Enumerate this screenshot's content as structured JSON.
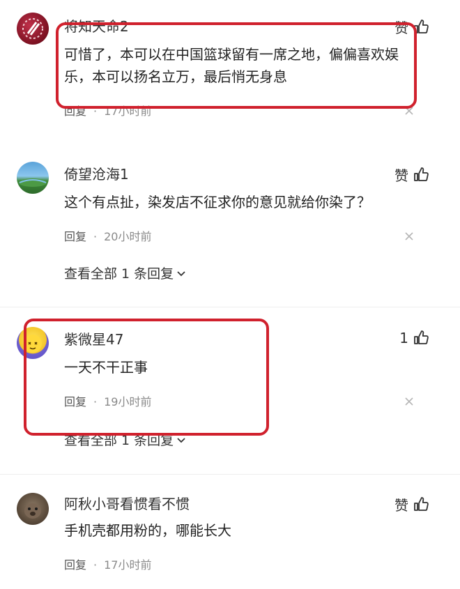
{
  "colors": {
    "highlight": "#d0212d",
    "muted": "#8a8a8a",
    "text": "#222222"
  },
  "comments": [
    {
      "username": "将知天命2",
      "like_label": "赞",
      "text": "可惜了，本可以在中国篮球留有一席之地，偏偏喜欢娱乐，本可以扬名立万，最后悄无身息",
      "reply_label": "回复",
      "separator": "·",
      "time": "17小时前"
    },
    {
      "username": "倚望沧海1",
      "like_label": "赞",
      "text": "这个有点扯，染发店不征求你的意见就给你染了？",
      "reply_label": "回复",
      "separator": "·",
      "time": "20小时前",
      "view_all": "查看全部 1 条回复"
    },
    {
      "username": "紫微星47",
      "like_label": "1",
      "text": "一天不干正事",
      "reply_label": "回复",
      "separator": "·",
      "time": "19小时前",
      "view_all": "查看全部 1 条回复"
    },
    {
      "username": "阿秋小哥看惯看不惯",
      "like_label": "赞",
      "text": "手机壳都用粉的，哪能长大",
      "reply_label": "回复",
      "separator": "·",
      "time": "17小时前"
    }
  ]
}
